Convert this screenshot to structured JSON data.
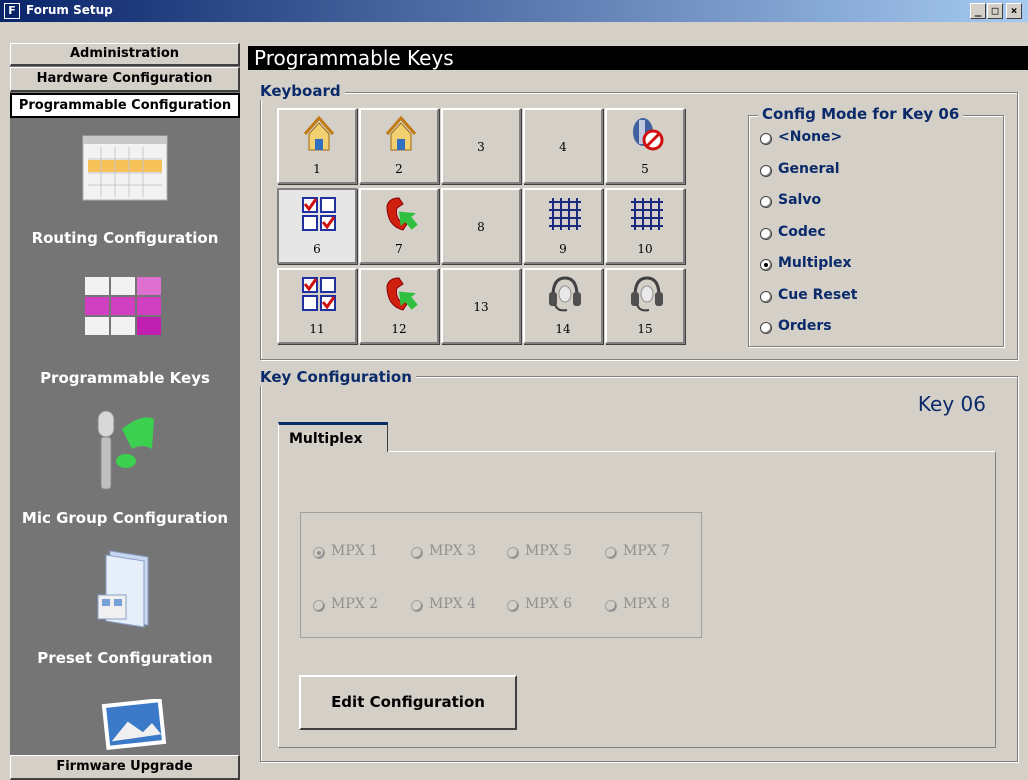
{
  "window": {
    "title": "Forum Setup",
    "app_icon_letter": "F",
    "controls": [
      "minimize",
      "maximize",
      "close"
    ]
  },
  "sidebar": {
    "top_buttons": [
      {
        "label": "Administration",
        "active": false
      },
      {
        "label": "Hardware Configuration",
        "active": false
      },
      {
        "label": "Programmable Configuration",
        "active": true
      }
    ],
    "items": [
      {
        "label": "Routing Configuration",
        "icon": "calendar-grid-icon"
      },
      {
        "label": "Programmable Keys",
        "icon": "pink-grid-icon"
      },
      {
        "label": "Mic Group Configuration",
        "icon": "microphone-note-icon"
      },
      {
        "label": "Preset Configuration",
        "icon": "folder-icon"
      },
      {
        "label": "",
        "icon": "photo-icon"
      }
    ],
    "bottom_button": "Firmware Upgrade"
  },
  "main": {
    "title": "Programmable Keys",
    "keyboard": {
      "label": "Keyboard",
      "keys": [
        {
          "num": "1",
          "icon": "house-icon"
        },
        {
          "num": "2",
          "icon": "house-icon"
        },
        {
          "num": "3",
          "icon": ""
        },
        {
          "num": "4",
          "icon": ""
        },
        {
          "num": "5",
          "icon": "blocked-speaker-icon"
        },
        {
          "num": "6",
          "icon": "checkbox-grid-icon",
          "selected": true
        },
        {
          "num": "7",
          "icon": "phone-arrow-icon"
        },
        {
          "num": "8",
          "icon": ""
        },
        {
          "num": "9",
          "icon": "matrix-grid-icon"
        },
        {
          "num": "10",
          "icon": "matrix-grid-icon"
        },
        {
          "num": "11",
          "icon": "checkbox-grid-icon"
        },
        {
          "num": "12",
          "icon": "phone-arrow-icon"
        },
        {
          "num": "13",
          "icon": ""
        },
        {
          "num": "14",
          "icon": "headset-icon"
        },
        {
          "num": "15",
          "icon": "headset-icon"
        }
      ]
    },
    "config_mode": {
      "label": "Config Mode for Key 06",
      "options": [
        "<None>",
        "General",
        "Salvo",
        "Codec",
        "Multiplex",
        "Cue Reset",
        "Orders"
      ],
      "selected": "Multiplex"
    },
    "key_config": {
      "label": "Key Configuration",
      "key_name": "Key 06",
      "tab": "Multiplex",
      "mpx_options": [
        "MPX 1",
        "MPX 3",
        "MPX 5",
        "MPX 7",
        "MPX 2",
        "MPX 4",
        "MPX 6",
        "MPX 8"
      ],
      "mpx_selected": "MPX 1",
      "edit_button": "Edit Configuration"
    }
  },
  "colors": {
    "accent": "#0a2a6a",
    "sidebar_bg": "#757575",
    "panel_bg": "#d4d0c8",
    "title_bar": "#0a246a"
  }
}
